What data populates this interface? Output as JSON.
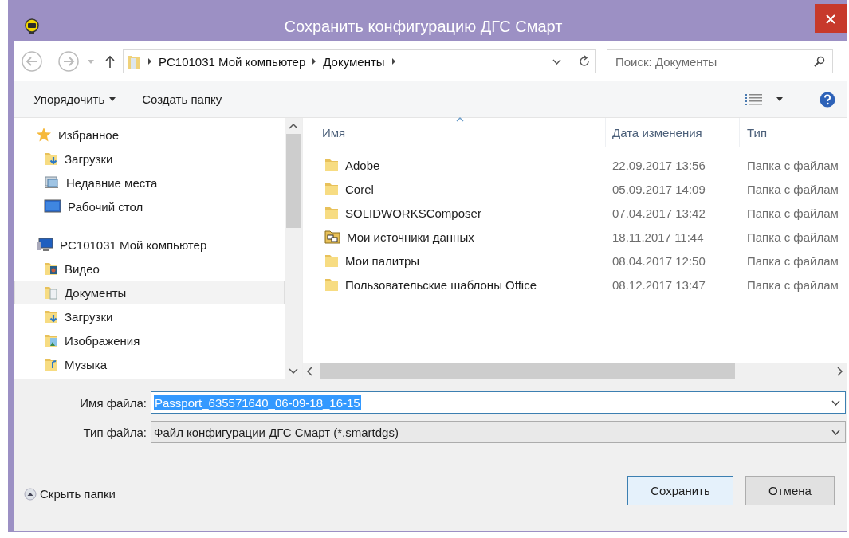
{
  "window": {
    "title": "Сохранить конфигурацию ДГС Смарт"
  },
  "address_bar": {
    "path": [
      "PC101031 Мой компьютер",
      "Документы"
    ]
  },
  "search": {
    "placeholder": "Поиск: Документы"
  },
  "toolbar": {
    "organize": "Упорядочить",
    "new_folder": "Создать папку"
  },
  "navigation": [
    {
      "label": "Избранное",
      "kind": "favorites",
      "selected": false,
      "children": [
        {
          "label": "Загрузки",
          "kind": "downloads",
          "selected": false
        },
        {
          "label": "Недавние места",
          "kind": "recent",
          "selected": false
        },
        {
          "label": "Рабочий стол",
          "kind": "desktop",
          "selected": false
        }
      ]
    },
    {
      "label": "PC101031 Мой компьютер",
      "kind": "computer",
      "selected": false,
      "children": [
        {
          "label": "Видео",
          "kind": "video",
          "selected": false
        },
        {
          "label": "Документы",
          "kind": "documents",
          "selected": true
        },
        {
          "label": "Загрузки",
          "kind": "downloads",
          "selected": false
        },
        {
          "label": "Изображения",
          "kind": "pictures",
          "selected": false
        },
        {
          "label": "Музыка",
          "kind": "music",
          "selected": false
        }
      ]
    }
  ],
  "file_list": {
    "columns": [
      "Имя",
      "Дата изменения",
      "Тип"
    ],
    "rows": [
      {
        "name": "Adobe",
        "modified": "22.09.2017 13:56",
        "type": "Папка с файлам",
        "kind": "folder"
      },
      {
        "name": "Corel",
        "modified": "05.09.2017 14:09",
        "type": "Папка с файлам",
        "kind": "folder"
      },
      {
        "name": "SOLIDWORKSComposer",
        "modified": "07.04.2017 13:42",
        "type": "Папка с файлам",
        "kind": "folder"
      },
      {
        "name": "Мои источники данных",
        "modified": "18.11.2017 11:44",
        "type": "Папка с файлам",
        "kind": "datasource"
      },
      {
        "name": "Мои палитры",
        "modified": "08.04.2017 12:50",
        "type": "Папка с файлам",
        "kind": "folder"
      },
      {
        "name": "Пользовательские шаблоны Office",
        "modified": "08.12.2017 13:47",
        "type": "Папка с файлам",
        "kind": "folder"
      }
    ]
  },
  "file_name": {
    "label": "Имя файла:",
    "value": "Passport_635571640_06-09-18_16-15",
    "selected": true
  },
  "file_type": {
    "label": "Тип файла:",
    "value": "Файл конфигурации ДГС Смарт (*.smartdgs)"
  },
  "hide_folders": "Скрыть папки",
  "buttons": [
    {
      "label": "Сохранить",
      "kind": "primary"
    },
    {
      "label": "Отмена",
      "kind": "secondary"
    }
  ]
}
